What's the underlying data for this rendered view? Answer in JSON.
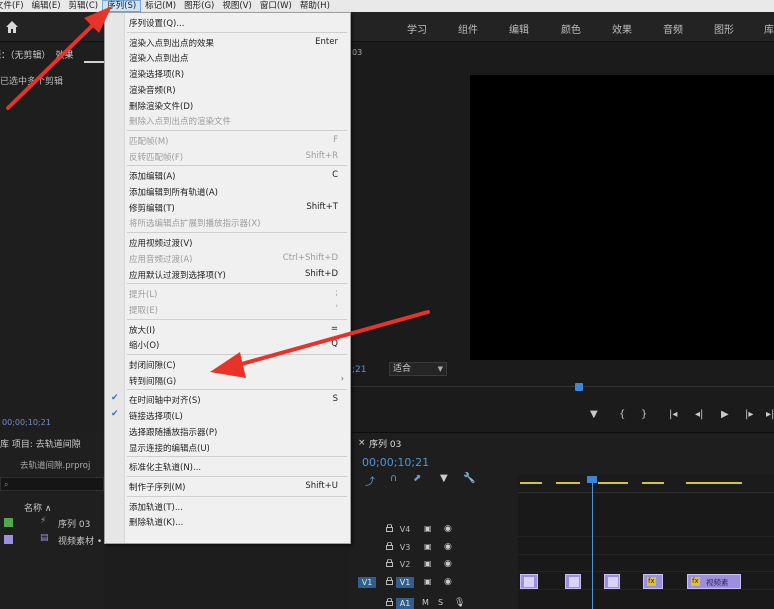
{
  "menubar": {
    "items": [
      "文件(F)",
      "编辑(E)",
      "剪辑(C)",
      "序列(S)",
      "标记(M)",
      "图形(G)",
      "视图(V)",
      "窗口(W)",
      "帮助(H)"
    ],
    "first_partial": "文件(F)"
  },
  "header": {
    "tabs": [
      "学习",
      "组件",
      "编辑",
      "颜色",
      "效果",
      "音频",
      "图形",
      "库"
    ]
  },
  "left_panel": {
    "source_tab": "源：（无剪辑）",
    "effects_tab": "效果",
    "meta": "已选中多个剪辑",
    "timecode": "00;00;10;21"
  },
  "program": {
    "tab": "03",
    "timecode": ";21",
    "fit": "适合",
    "transport": [
      "▼",
      "{",
      "}",
      "|◂",
      "◂|",
      "▶",
      "|▸",
      "▸|"
    ]
  },
  "project": {
    "tabs": "库    项目: 去轨道间隙",
    "file": "去轨道间隙.prproj",
    "column_name": "名称 ∧",
    "rows": [
      {
        "name": "序列 03",
        "color": "#4fa84a"
      },
      {
        "name": "视频素材 •",
        "color": "#9d8ee0"
      }
    ]
  },
  "timeline": {
    "title": "序列 03",
    "timecode": "00;00;10;21",
    "tracks": [
      "V4",
      "V3",
      "V2",
      "V1",
      "A1"
    ],
    "source_label": "V1",
    "clip_label": "视频素",
    "fx": "fx",
    "a1_m": "M",
    "a1_s": "S"
  },
  "menu": {
    "items": [
      {
        "label": "序列设置(Q)...",
        "shortcut": "",
        "disabled": false
      },
      {
        "sep": true
      },
      {
        "label": "渲染入点到出点的效果",
        "shortcut": "Enter",
        "disabled": false
      },
      {
        "label": "渲染入点到出点",
        "shortcut": "",
        "disabled": false
      },
      {
        "label": "渲染选择项(R)",
        "shortcut": "",
        "disabled": false
      },
      {
        "label": "渲染音频(R)",
        "shortcut": "",
        "disabled": false
      },
      {
        "label": "删除渲染文件(D)",
        "shortcut": "",
        "disabled": false
      },
      {
        "label": "删除入点到出点的渲染文件",
        "shortcut": "",
        "disabled": true
      },
      {
        "sep": true
      },
      {
        "label": "匹配帧(M)",
        "shortcut": "F",
        "disabled": true
      },
      {
        "label": "反转匹配帧(F)",
        "shortcut": "Shift+R",
        "disabled": true
      },
      {
        "sep": true
      },
      {
        "label": "添加编辑(A)",
        "shortcut": "C",
        "disabled": false
      },
      {
        "label": "添加编辑到所有轨道(A)",
        "shortcut": "",
        "disabled": false
      },
      {
        "label": "修剪编辑(T)",
        "shortcut": "Shift+T",
        "disabled": false
      },
      {
        "label": "将所选编辑点扩展到播放指示器(X)",
        "shortcut": "",
        "disabled": true
      },
      {
        "sep": true
      },
      {
        "label": "应用视频过渡(V)",
        "shortcut": "",
        "disabled": false
      },
      {
        "label": "应用音频过渡(A)",
        "shortcut": "Ctrl+Shift+D",
        "disabled": true
      },
      {
        "label": "应用默认过渡到选择项(Y)",
        "shortcut": "Shift+D",
        "disabled": false
      },
      {
        "sep": true
      },
      {
        "label": "提升(L)",
        "shortcut": ";",
        "disabled": true
      },
      {
        "label": "提取(E)",
        "shortcut": "'",
        "disabled": true
      },
      {
        "sep": true
      },
      {
        "label": "放大(I)",
        "shortcut": "=",
        "disabled": false
      },
      {
        "label": "缩小(O)",
        "shortcut": "Q",
        "disabled": false
      },
      {
        "sep": true
      },
      {
        "label": "封闭间隙(C)",
        "shortcut": "",
        "disabled": false
      },
      {
        "label": "转到间隔(G)",
        "shortcut": "",
        "disabled": false,
        "submenu": true
      },
      {
        "sep": true
      },
      {
        "label": "在时间轴中对齐(S)",
        "shortcut": "S",
        "disabled": false,
        "checked": true
      },
      {
        "label": "链接选择项(L)",
        "shortcut": "",
        "disabled": false,
        "checked": true
      },
      {
        "label": "选择跟随播放指示器(P)",
        "shortcut": "",
        "disabled": false
      },
      {
        "label": "显示连接的编辑点(U)",
        "shortcut": "",
        "disabled": false
      },
      {
        "sep": true
      },
      {
        "label": "标准化主轨道(N)...",
        "shortcut": "",
        "disabled": false
      },
      {
        "sep": true
      },
      {
        "label": "制作子序列(M)",
        "shortcut": "Shift+U",
        "disabled": false
      },
      {
        "sep": true
      },
      {
        "label": "添加轨道(T)...",
        "shortcut": "",
        "disabled": false
      },
      {
        "label": "删除轨道(K)...",
        "shortcut": "",
        "disabled": false
      }
    ]
  },
  "colors": {
    "accent": "#4e95d8",
    "arrow": "#e8332a",
    "clip": "#9d8ee0"
  }
}
